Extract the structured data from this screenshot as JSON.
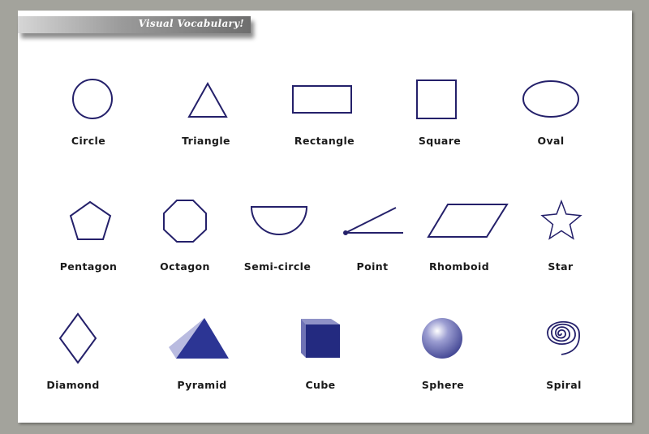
{
  "banner": {
    "title": "Visual Vocabulary!"
  },
  "colors": {
    "stroke": "#24206a",
    "fill": "#24287a",
    "background": "#a3a39c"
  },
  "shapes": [
    {
      "id": "circle",
      "label": "Circle"
    },
    {
      "id": "triangle",
      "label": "Triangle"
    },
    {
      "id": "rectangle",
      "label": "Rectangle"
    },
    {
      "id": "square",
      "label": "Square"
    },
    {
      "id": "oval",
      "label": "Oval"
    },
    {
      "id": "pentagon",
      "label": "Pentagon"
    },
    {
      "id": "octagon",
      "label": "Octagon"
    },
    {
      "id": "semi-circle",
      "label": "Semi-circle"
    },
    {
      "id": "point",
      "label": "Point"
    },
    {
      "id": "rhomboid",
      "label": "Rhomboid"
    },
    {
      "id": "star",
      "label": "Star"
    },
    {
      "id": "diamond",
      "label": "Diamond"
    },
    {
      "id": "pyramid",
      "label": "Pyramid"
    },
    {
      "id": "cube",
      "label": "Cube"
    },
    {
      "id": "sphere",
      "label": "Sphere"
    },
    {
      "id": "spiral",
      "label": "Spiral"
    }
  ]
}
